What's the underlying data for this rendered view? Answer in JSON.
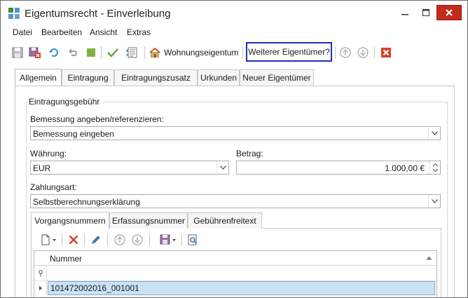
{
  "window": {
    "title": "Eigentumsrecht - Einverleibung"
  },
  "menu": {
    "items": [
      "Datei",
      "Bearbeiten",
      "Ansicht",
      "Extras"
    ]
  },
  "toolbar": {
    "wohnungseigentum_label": "Wohnungseigentum",
    "weiterer_label": "Weiterer Eigentümer?"
  },
  "tabs": [
    "Allgemein",
    "Eintragung",
    "Eintragungszusatz",
    "Urkunden",
    "Neuer Eigentümer"
  ],
  "group": {
    "legend": "Eintragungsgebühr"
  },
  "form": {
    "bemessung_label": "Bemessung angeben/referenzieren:",
    "bemessung_value": "Bemessung eingeben",
    "waehrung_label": "Währung:",
    "waehrung_value": "EUR",
    "betrag_label": "Betrag:",
    "betrag_value": "1.000,00 €",
    "zahlungsart_label": "Zahlungsart:",
    "zahlungsart_value": "Selbstberechnungserklärung"
  },
  "subtabs": [
    "Vorgangsnummern",
    "Erfassungsnummer",
    "Gebührenfreitext"
  ],
  "grid": {
    "column": "Nummer",
    "rows": [
      "101472002016_001001"
    ]
  },
  "colors": {
    "highlight_border": "#1f2fb8",
    "close_red": "#c42b1c",
    "selection": "#c9e2f5"
  }
}
